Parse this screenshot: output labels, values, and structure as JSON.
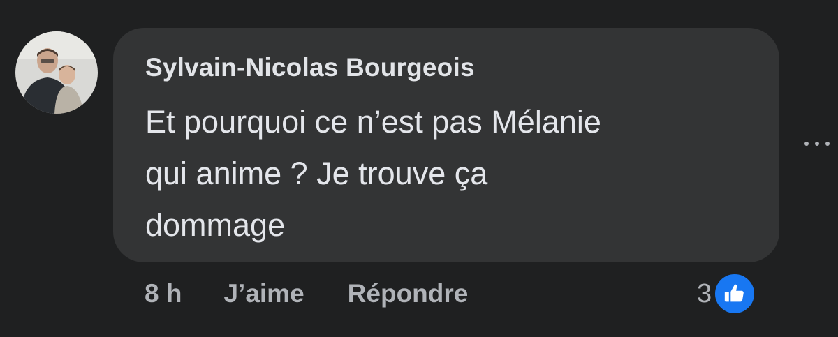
{
  "comment": {
    "author": "Sylvain-Nicolas Bourgeois",
    "text": "Et pourquoi ce n’est pas Mélanie\nqui anime ? Je trouve ça\ndommage",
    "avatar_icon": "profile-photo"
  },
  "actions": {
    "timestamp": "8 h",
    "like_label": "J’aime",
    "reply_label": "Répondre"
  },
  "reactions": {
    "count": "3",
    "icon": "thumbs-up-icon",
    "color": "#1877f2"
  },
  "more_icon": "more-options-icon"
}
